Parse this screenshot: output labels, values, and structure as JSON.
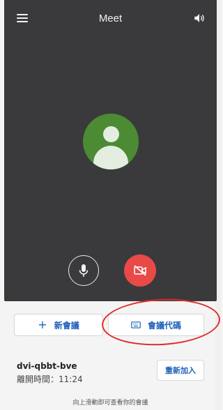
{
  "header": {
    "title": "Meet",
    "menu_icon": "menu-icon",
    "speaker_icon": "volume-icon"
  },
  "controls": {
    "mic_icon": "microphone-icon",
    "camera_icon": "camera-off-icon",
    "camera_color": "#e84a47"
  },
  "actions": {
    "new_meeting_label": "新會議",
    "new_meeting_icon": "plus-icon",
    "meeting_code_label": "會議代碼",
    "meeting_code_icon": "keyboard-icon"
  },
  "recent": {
    "meeting_id": "dvi-qbbt-bve",
    "left_time": "離開時間：11:24",
    "rejoin_label": "重新加入"
  },
  "footer": {
    "hint": "向上滑動即可查看你的會議"
  },
  "colors": {
    "accent": "#1d5fb8",
    "avatar_bg": "#4c8b34",
    "annotation": "#e12a25"
  }
}
